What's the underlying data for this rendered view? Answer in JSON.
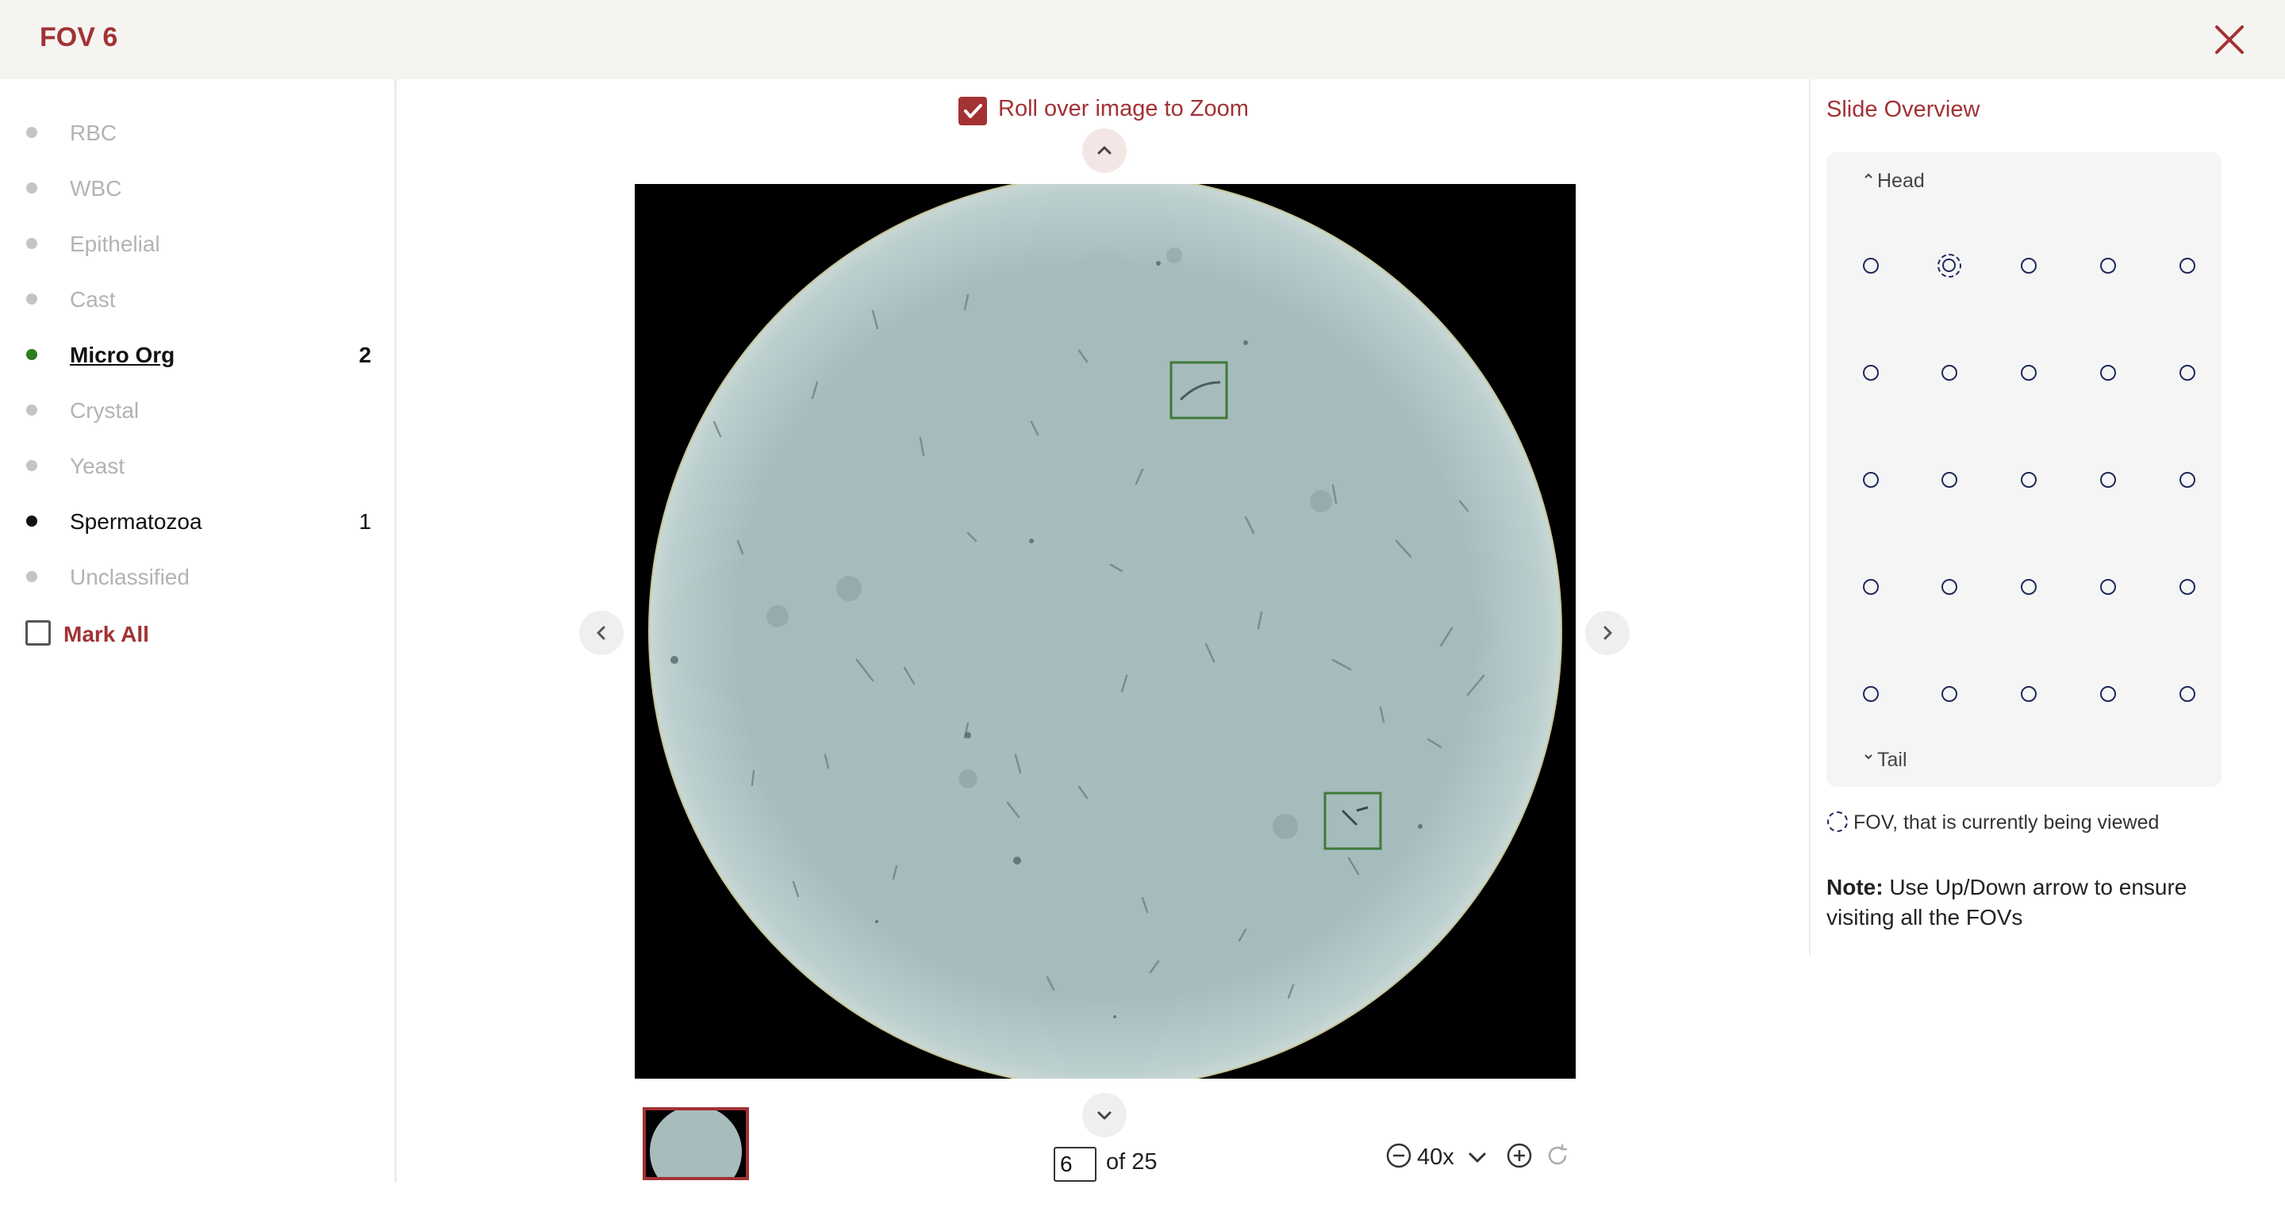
{
  "header": {
    "title": "FOV 6"
  },
  "sidebar": {
    "categories": [
      {
        "label": "RBC",
        "count": ""
      },
      {
        "label": "WBC",
        "count": ""
      },
      {
        "label": "Epithelial",
        "count": ""
      },
      {
        "label": "Cast",
        "count": ""
      },
      {
        "label": "Micro Org",
        "count": "2"
      },
      {
        "label": "Crystal",
        "count": ""
      },
      {
        "label": "Yeast",
        "count": ""
      },
      {
        "label": "Spermatozoa",
        "count": "1"
      },
      {
        "label": "Unclassified",
        "count": ""
      }
    ],
    "mark_all": "Mark All"
  },
  "viewer": {
    "roll_over_label": "Roll over image to Zoom",
    "roll_over_checked": true,
    "current_page": "6",
    "of_label": "of 25",
    "zoom_level": "40x"
  },
  "overview": {
    "title": "Slide Overview",
    "head_label": "Head",
    "tail_label": "Tail",
    "legend": "FOV, that is currently being viewed",
    "note_bold": "Note:",
    "note_text": " Use Up/Down arrow to ensure visiting all the FOVs"
  },
  "colors": {
    "accent": "#a23234",
    "green_dot": "#2e7d1f",
    "black_dot": "#111111",
    "muted": "#b3b3b3",
    "grid_dot": "#1f2a5a"
  }
}
